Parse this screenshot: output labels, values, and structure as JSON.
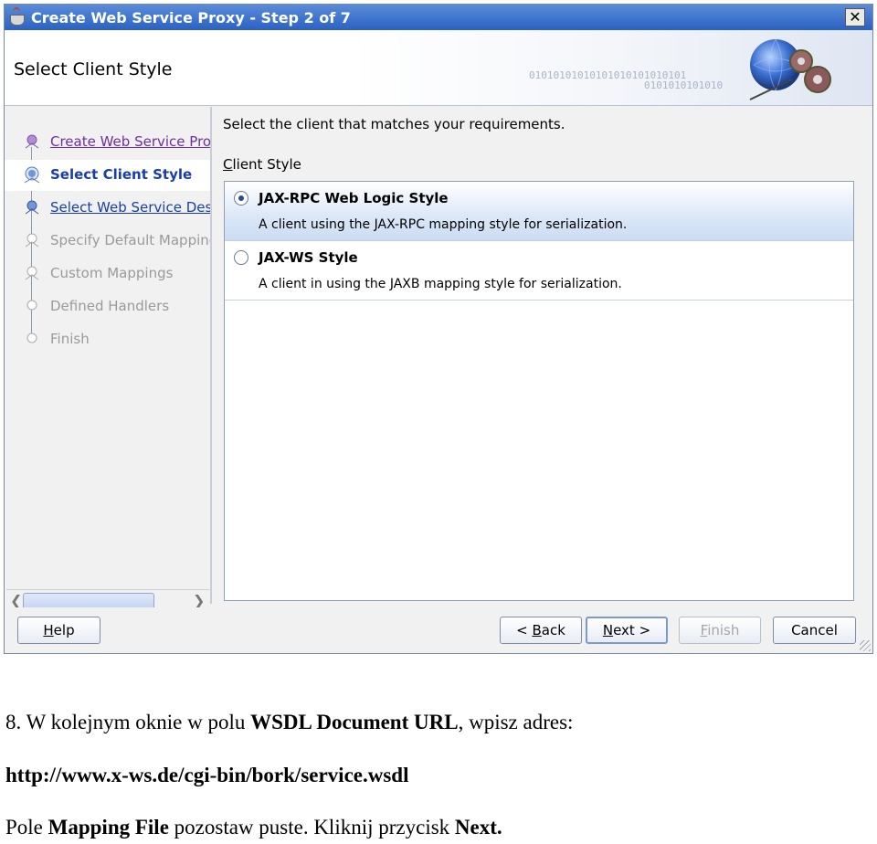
{
  "dialog": {
    "title": "Create Web Service Proxy - Step 2 of 7",
    "header_title": "Select Client Style",
    "header_binary": [
      "01010101010101010101010101",
      "0101010101010"
    ],
    "steps": [
      {
        "label": "Create Web Service Proxy",
        "state": "visited"
      },
      {
        "label": "Select Client Style",
        "state": "active"
      },
      {
        "label": "Select Web Service Description",
        "state": "link"
      },
      {
        "label": "Specify Default Mapping Options",
        "state": "disabled"
      },
      {
        "label": "Custom Mappings",
        "state": "disabled"
      },
      {
        "label": "Defined Handlers",
        "state": "disabled"
      },
      {
        "label": "Finish",
        "state": "disabled"
      }
    ],
    "instructions": "Select the client that matches your requirements.",
    "group_label_mnemonic": "C",
    "group_label_rest": "lient Style",
    "options": [
      {
        "title": "JAX-RPC Web Logic Style",
        "description": "A client using the JAX-RPC mapping style for serialization.",
        "selected": true
      },
      {
        "title": "JAX-WS Style",
        "description": "A client in using the JAXB mapping style for serialization.",
        "selected": false
      }
    ],
    "buttons": {
      "help_mnemonic": "H",
      "help_rest": "elp",
      "back_pre": "< ",
      "back_mnemonic": "B",
      "back_rest": "ack",
      "next_mnemonic": "N",
      "next_rest": "ext >",
      "finish_mnemonic": "F",
      "finish_rest": "inish",
      "cancel": "Cancel"
    }
  },
  "document": {
    "line1_a": "8. W kolejnym oknie w polu ",
    "line1_b": "WSDL Document URL",
    "line1_c": ", wpisz adres:",
    "line2": "http://www.x-ws.de/cgi-bin/bork/service.wsdl",
    "line3_a": "Pole ",
    "line3_b": "Mapping File",
    "line3_c": " pozostaw puste. Kliknij przycisk ",
    "line3_d": "Next."
  }
}
